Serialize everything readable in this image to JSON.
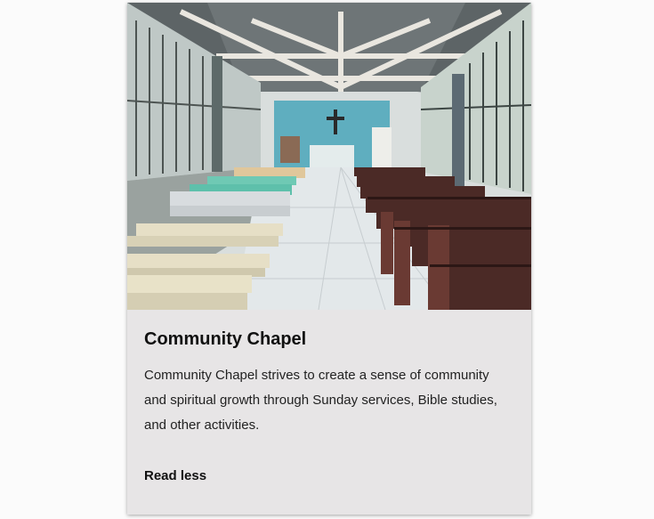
{
  "card": {
    "image_alt": "Interior of an open-air chapel with rows of wooden and concrete pews facing an altar with a cross",
    "title": "Community Chapel",
    "description": "Community Chapel strives to create a sense of community and spiritual growth through Sunday services, Bible studies, and other activities.",
    "toggle_label": "Read less"
  }
}
